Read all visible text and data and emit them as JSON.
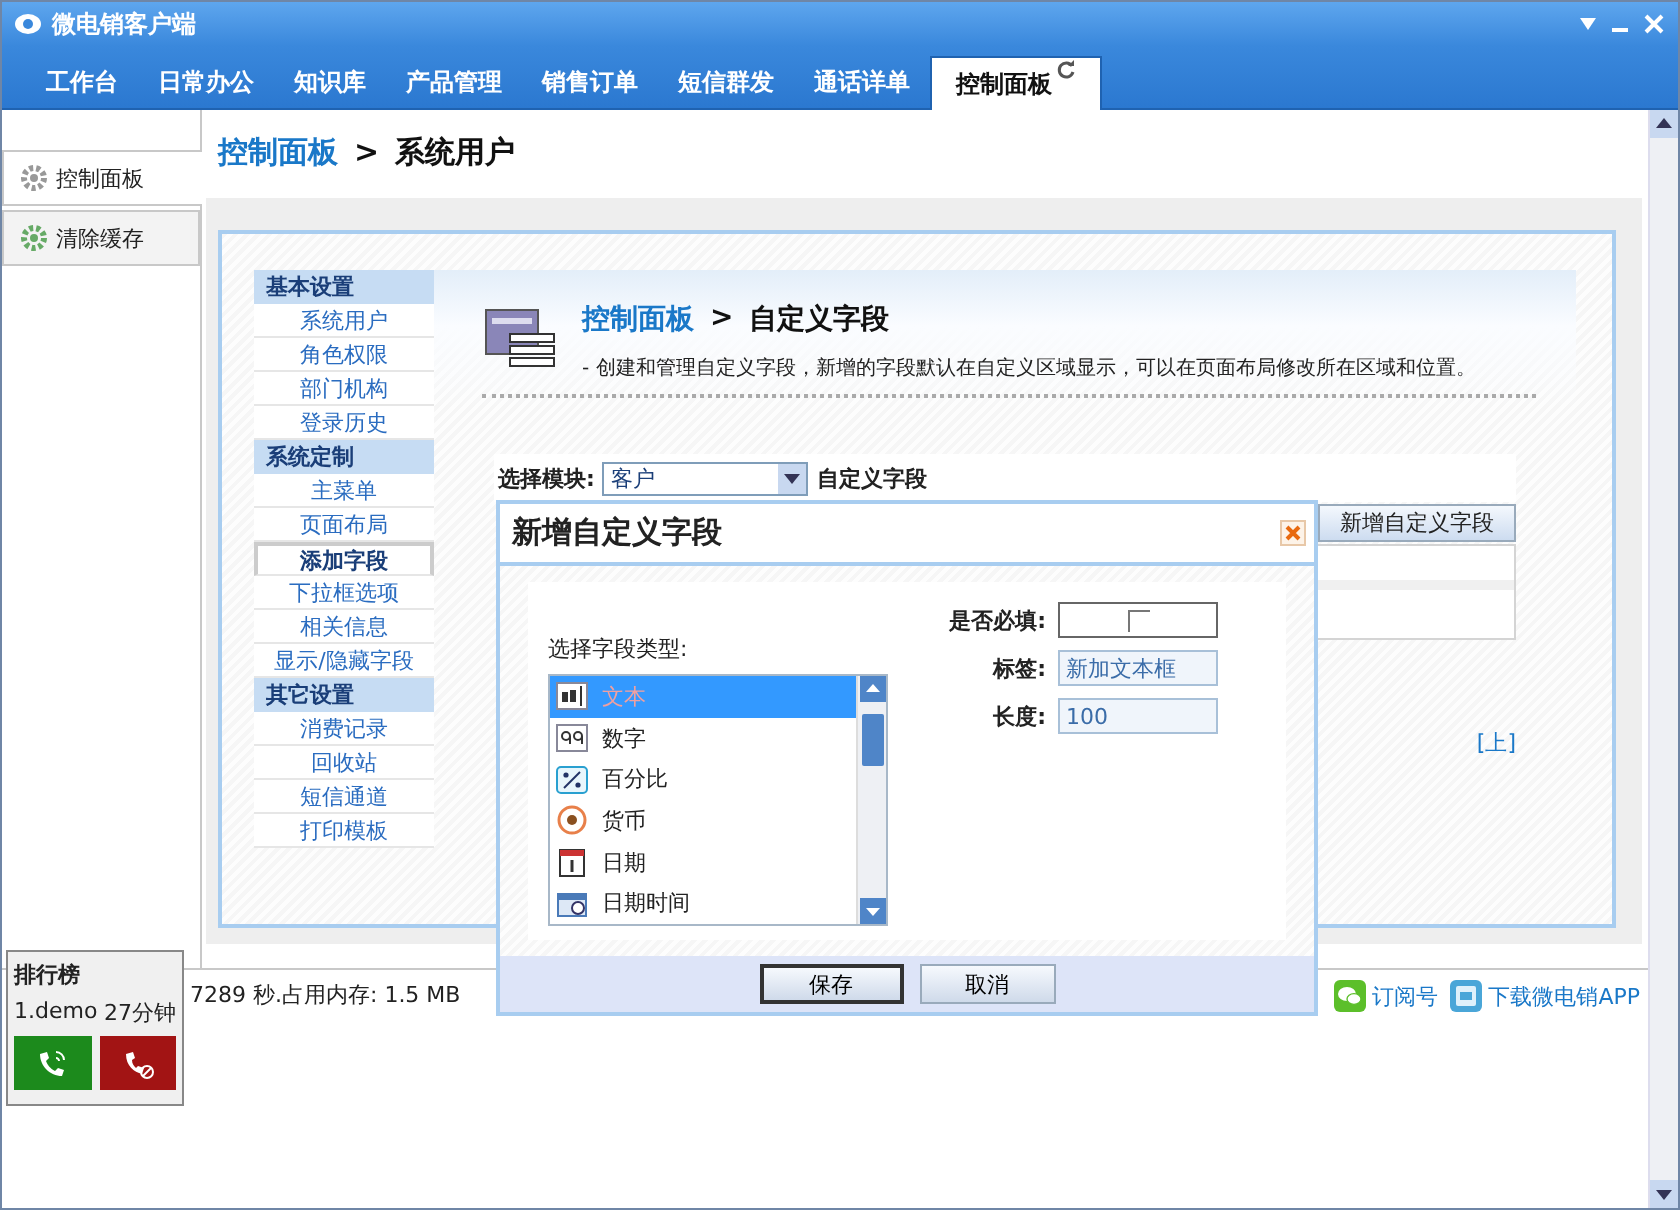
{
  "window": {
    "title": "微电销客户端"
  },
  "tabs": [
    {
      "label": "工作台",
      "selected": false
    },
    {
      "label": "日常办公",
      "selected": false
    },
    {
      "label": "知识库",
      "selected": false
    },
    {
      "label": "产品管理",
      "selected": false
    },
    {
      "label": "销售订单",
      "selected": false
    },
    {
      "label": "短信群发",
      "selected": false
    },
    {
      "label": "通话详单",
      "selected": false
    },
    {
      "label": "控制面板",
      "selected": true
    }
  ],
  "sidebar": {
    "items": [
      {
        "label": "控制面板",
        "selected": true
      },
      {
        "label": "清除缓存",
        "selected": false
      }
    ]
  },
  "breadcrumb": {
    "parent": "控制面板",
    "separator": ">",
    "current": "系统用户"
  },
  "settings_nav": {
    "sections": [
      {
        "title": "基本设置",
        "items": [
          {
            "label": "系统用户",
            "selected": false
          },
          {
            "label": "角色权限",
            "selected": false
          },
          {
            "label": "部门机构",
            "selected": false
          },
          {
            "label": "登录历史",
            "selected": false
          }
        ]
      },
      {
        "title": "系统定制",
        "items": [
          {
            "label": "主菜单",
            "selected": false
          },
          {
            "label": "页面布局",
            "selected": false
          },
          {
            "label": "添加字段",
            "selected": true
          },
          {
            "label": "下拉框选项",
            "selected": false
          },
          {
            "label": "相关信息",
            "selected": false
          },
          {
            "label": "显示/隐藏字段",
            "selected": false
          }
        ]
      },
      {
        "title": "其它设置",
        "items": [
          {
            "label": "消费记录",
            "selected": false
          },
          {
            "label": "回收站",
            "selected": false
          },
          {
            "label": "短信通道",
            "selected": false
          },
          {
            "label": "打印模板",
            "selected": false
          }
        ]
      }
    ]
  },
  "page_header": {
    "parent": "控制面板",
    "separator": ">",
    "title": "自定义字段",
    "description": "- 创建和管理自定义字段，新增的字段默认在自定义区域显示，可以在页面布局修改所在区域和位置。"
  },
  "module_select": {
    "label": "选择模块:",
    "value": "客户",
    "suffix": "自定义字段"
  },
  "add_button": "新增自定义字段",
  "top_link": "[上]",
  "status": {
    "text": "7289 秒.占用内存: 1.5 MB",
    "links": [
      {
        "label": "订阅号",
        "kind": "wechat"
      },
      {
        "label": "下载微电销APP",
        "kind": "app"
      }
    ]
  },
  "leaderboard": {
    "title": "排行榜",
    "entries": [
      {
        "name": "1.demo",
        "time": "27分钟"
      }
    ]
  },
  "dialog": {
    "title": "新增自定义字段",
    "type_label": "选择字段类型:",
    "types": [
      {
        "label": "文本",
        "kind": "text",
        "selected": true
      },
      {
        "label": "数字",
        "kind": "number",
        "selected": false
      },
      {
        "label": "百分比",
        "kind": "percent",
        "selected": false
      },
      {
        "label": "货币",
        "kind": "currency",
        "selected": false
      },
      {
        "label": "日期",
        "kind": "date",
        "selected": false
      },
      {
        "label": "日期时间",
        "kind": "datetime",
        "selected": false
      }
    ],
    "required": {
      "label": "是否必填:",
      "checked": false
    },
    "fields": [
      {
        "label": "标签:",
        "value": "新加文本框"
      },
      {
        "label": "长度:",
        "value": "100"
      }
    ],
    "buttons": [
      {
        "label": "保存",
        "default": true
      },
      {
        "label": "取消",
        "default": false
      }
    ]
  }
}
